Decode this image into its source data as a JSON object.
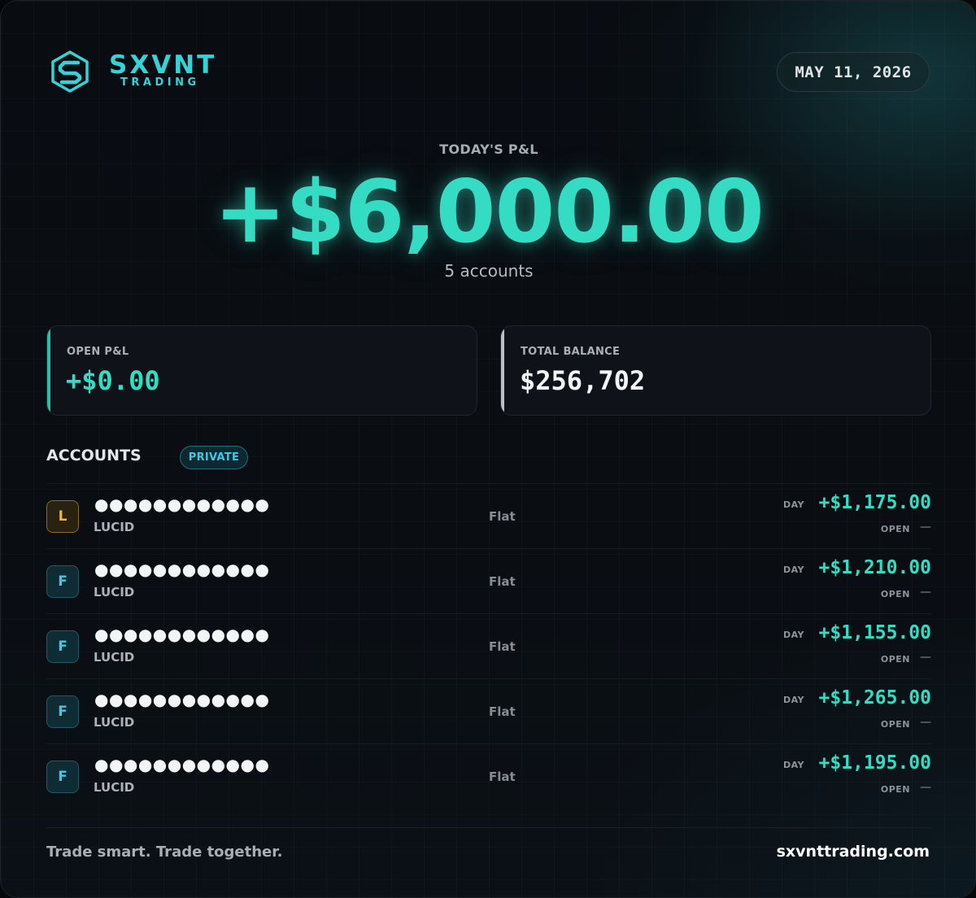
{
  "header": {
    "brand_name": "SXVNT",
    "brand_sub": "TRADING",
    "date": "MAY 11, 2026",
    "logo_icon": "sxvnt-s-logo-icon"
  },
  "summary": {
    "label": "TODAY'S P&L",
    "value": "+$6,000.00",
    "accounts_count": "5 accounts"
  },
  "stats": {
    "open_pnl": {
      "label": "OPEN P&L",
      "value": "+$0.00"
    },
    "total_balance": {
      "label": "TOTAL BALANCE",
      "value": "$256,702"
    }
  },
  "accounts": {
    "title": "ACCOUNTS",
    "badge": "PRIVATE",
    "day_label": "DAY",
    "open_label": "OPEN",
    "items": [
      {
        "avatar": "L",
        "name": "●●●●●●●●●●●●",
        "firm": "LUCID",
        "status": "Flat",
        "day": "+$1,175.00",
        "open": "—"
      },
      {
        "avatar": "F",
        "name": "●●●●●●●●●●●●",
        "firm": "LUCID",
        "status": "Flat",
        "day": "+$1,210.00",
        "open": "—"
      },
      {
        "avatar": "F",
        "name": "●●●●●●●●●●●●",
        "firm": "LUCID",
        "status": "Flat",
        "day": "+$1,155.00",
        "open": "—"
      },
      {
        "avatar": "F",
        "name": "●●●●●●●●●●●●",
        "firm": "LUCID",
        "status": "Flat",
        "day": "+$1,265.00",
        "open": "—"
      },
      {
        "avatar": "F",
        "name": "●●●●●●●●●●●●",
        "firm": "LUCID",
        "status": "Flat",
        "day": "+$1,195.00",
        "open": "—"
      }
    ]
  },
  "footer": {
    "tagline": "Trade smart. Trade together.",
    "site": "sxvnttrading.com"
  },
  "colors": {
    "accent": "#34dcc3",
    "brand": "#36d3d6",
    "badge": "#3ccbe4",
    "avatar_l": "#f2b630"
  }
}
